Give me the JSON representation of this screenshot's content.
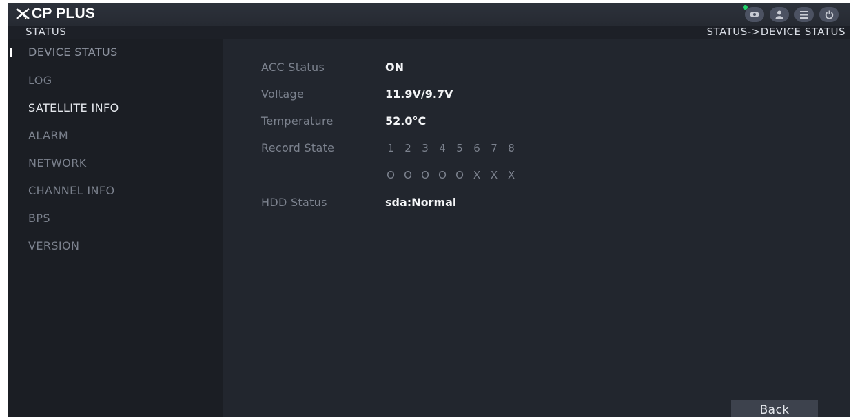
{
  "header": {
    "brand": "CP PLUS",
    "icons": [
      "eye-icon",
      "user-icon",
      "menu-icon",
      "power-icon"
    ],
    "status_dot_color": "#22d36a"
  },
  "subbar": {
    "section": "STATUS",
    "breadcrumb": "STATUS->DEVICE STATUS"
  },
  "sidebar": {
    "items": [
      {
        "label": "DEVICE STATUS"
      },
      {
        "label": "LOG"
      },
      {
        "label": "SATELLITE INFO"
      },
      {
        "label": "ALARM"
      },
      {
        "label": "NETWORK"
      },
      {
        "label": "CHANNEL INFO"
      },
      {
        "label": "BPS"
      },
      {
        "label": "VERSION"
      }
    ]
  },
  "status": {
    "acc": {
      "label": "ACC Status",
      "value": "ON"
    },
    "voltage": {
      "label": "Voltage",
      "value": "11.9V/9.7V"
    },
    "temperature": {
      "label": "Temperature",
      "value": "52.0°C"
    },
    "record": {
      "label": "Record State",
      "channels": [
        "1",
        "2",
        "3",
        "4",
        "5",
        "6",
        "7",
        "8"
      ],
      "states": [
        "O",
        "O",
        "O",
        "O",
        "O",
        "X",
        "X",
        "X"
      ]
    },
    "hdd": {
      "label": "HDD Status",
      "value": "sda:Normal"
    }
  },
  "footer": {
    "back_label": "Back"
  }
}
